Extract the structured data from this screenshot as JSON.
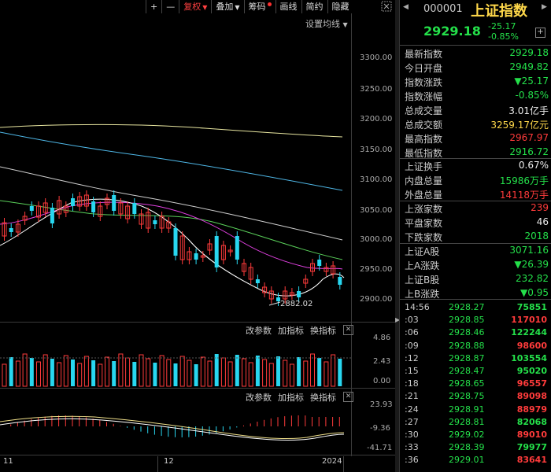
{
  "toolbar": {
    "plus": "+",
    "minus": "—",
    "fuquan": "复权",
    "diejia": "叠加",
    "chouma": "筹码",
    "huaxian": "画线",
    "jianyue": "简约",
    "yincang": "隐藏"
  },
  "main_chart": {
    "set_ma_label": "设置均线",
    "y_ticks": [
      "3300.00",
      "3250.00",
      "3200.00",
      "3150.00",
      "3100.00",
      "3050.00",
      "3000.00",
      "2950.00",
      "2900.00"
    ],
    "low_marker": "2882.02"
  },
  "volume_panel": {
    "btn_change_param": "改参数",
    "btn_add_indicator": "加指标",
    "btn_swap_indicator": "换指标",
    "y_ticks": [
      "4.86",
      "2.43",
      "0.00"
    ]
  },
  "macd_panel": {
    "btn_change_param": "改参数",
    "btn_add_indicator": "加指标",
    "btn_swap_indicator": "换指标",
    "y_ticks": [
      "23.93",
      "-9.36",
      "-41.71"
    ]
  },
  "x_axis": {
    "labels": [
      "11",
      "12",
      "2024"
    ]
  },
  "quote": {
    "code": "000001",
    "name": "上证指数",
    "price": "2929.18",
    "change": "-25.17",
    "change_pct": "-0.85%",
    "stats": [
      {
        "label": "最新指数",
        "value": "2929.18",
        "color": "#24e04a"
      },
      {
        "label": "今日开盘",
        "value": "2949.82",
        "color": "#24e04a"
      },
      {
        "label": "指数涨跌",
        "value": "▼25.17",
        "color": "#24e04a"
      },
      {
        "label": "指数涨幅",
        "value": "-0.85%",
        "color": "#24e04a"
      },
      {
        "label": "总成交量",
        "value": "3.01亿手",
        "color": "#eeeeee"
      },
      {
        "label": "总成交额",
        "value": "3259.17亿元",
        "color": "#ffd84a"
      },
      {
        "label": "最高指数",
        "value": "2967.97",
        "color": "#ff3b3b"
      },
      {
        "label": "最低指数",
        "value": "2916.72",
        "color": "#24e04a"
      }
    ],
    "stats2": [
      {
        "label": "上证换手",
        "value": "0.67%",
        "color": "#eeeeee"
      },
      {
        "label": "内盘总量",
        "value": "15986万手",
        "color": "#24e04a"
      },
      {
        "label": "外盘总量",
        "value": "14118万手",
        "color": "#ff3b3b"
      }
    ],
    "stats3": [
      {
        "label": "上涨家数",
        "value": "239",
        "color": "#ff3b3b"
      },
      {
        "label": "平盘家数",
        "value": "46",
        "color": "#eeeeee"
      },
      {
        "label": "下跌家数",
        "value": "2018",
        "color": "#24e04a"
      }
    ],
    "stats4": [
      {
        "label": "上证A股",
        "value": "3071.16",
        "color": "#24e04a"
      },
      {
        "label": "上A涨跌",
        "value": "▼26.39",
        "color": "#24e04a"
      },
      {
        "label": "上证B股",
        "value": "232.82",
        "color": "#24e04a"
      },
      {
        "label": "上B涨跌",
        "value": "▼0.95",
        "color": "#24e04a"
      }
    ],
    "ticks": [
      {
        "time": "14:56",
        "price": "2928.27",
        "vol": "75851",
        "color": "#24e04a"
      },
      {
        "time": ":03",
        "price": "2928.85",
        "vol": "117010",
        "color": "#ff3b3b"
      },
      {
        "time": ":06",
        "price": "2928.46",
        "vol": "122244",
        "color": "#24e04a"
      },
      {
        "time": ":09",
        "price": "2928.88",
        "vol": "98600",
        "color": "#ff3b3b"
      },
      {
        "time": ":12",
        "price": "2928.87",
        "vol": "103554",
        "color": "#24e04a"
      },
      {
        "time": ":15",
        "price": "2928.47",
        "vol": "95020",
        "color": "#24e04a"
      },
      {
        "time": ":18",
        "price": "2928.65",
        "vol": "96557",
        "color": "#ff3b3b"
      },
      {
        "time": ":21",
        "price": "2928.75",
        "vol": "89098",
        "color": "#ff3b3b"
      },
      {
        "time": ":24",
        "price": "2928.91",
        "vol": "88979",
        "color": "#ff3b3b"
      },
      {
        "time": ":27",
        "price": "2928.81",
        "vol": "82068",
        "color": "#24e04a"
      },
      {
        "time": ":30",
        "price": "2929.02",
        "vol": "89010",
        "color": "#ff3b3b"
      },
      {
        "time": ":33",
        "price": "2928.39",
        "vol": "79977",
        "color": "#24e04a"
      },
      {
        "time": ":36",
        "price": "2929.01",
        "vol": "83641",
        "color": "#ff3b3b"
      }
    ]
  }
}
